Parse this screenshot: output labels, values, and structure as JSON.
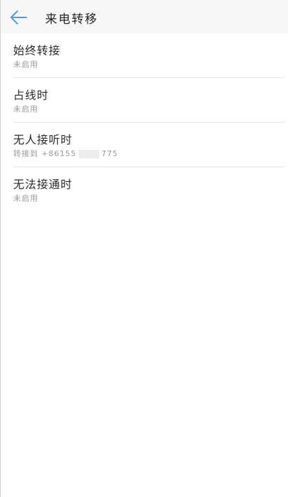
{
  "header": {
    "title": "来电转移",
    "back_icon": "arrow-left-icon",
    "accent_color": "#4a9fd5"
  },
  "items": [
    {
      "title": "始终转接",
      "subtitle": "未启用"
    },
    {
      "title": "占线时",
      "subtitle": "未启用"
    },
    {
      "title": "无人接听时",
      "subtitle_prefix": "转接到 +86155",
      "subtitle_suffix": "775"
    },
    {
      "title": "无法接通时",
      "subtitle": "未启用"
    }
  ]
}
